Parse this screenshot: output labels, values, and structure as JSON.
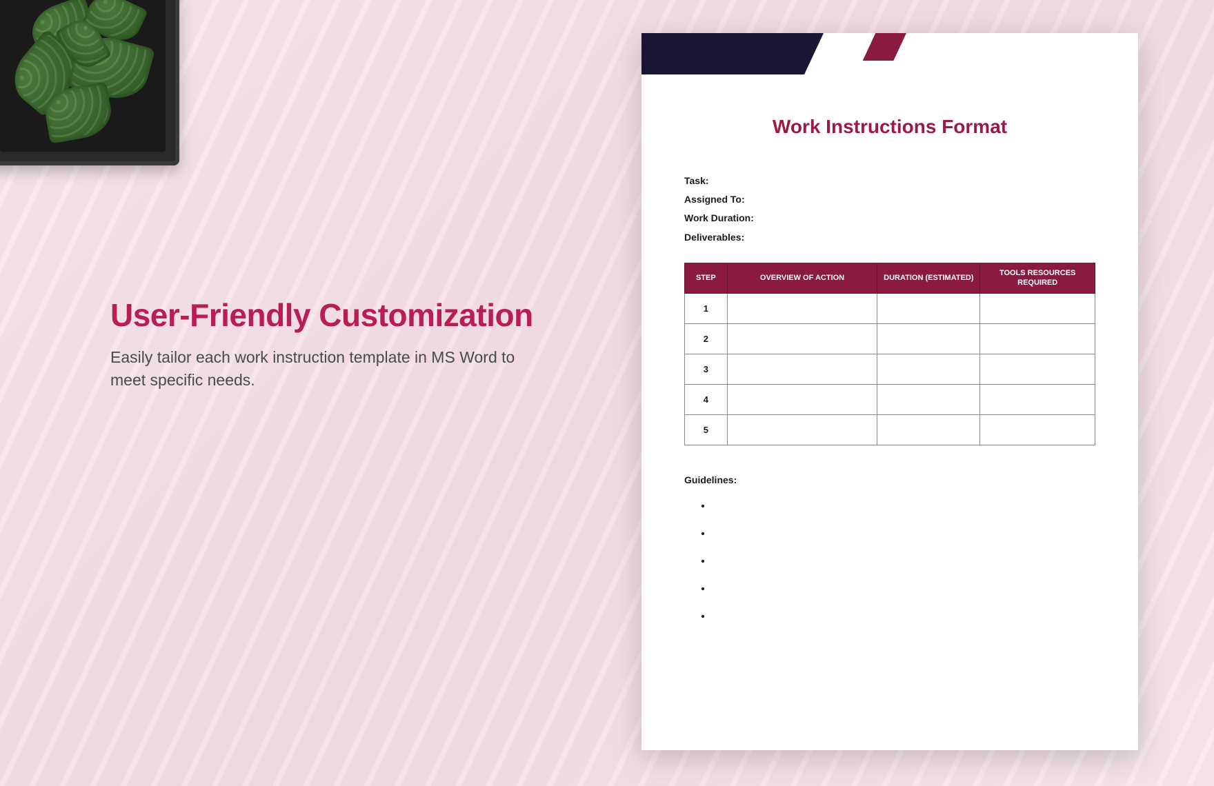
{
  "marketing": {
    "headline": "User-Friendly Customization",
    "subhead": "Easily tailor each work instruction template  in MS Word to meet specific needs."
  },
  "document": {
    "title": "Work Instructions Format",
    "fields": {
      "task_label": "Task:",
      "assigned_label": "Assigned To:",
      "duration_label": "Work Duration:",
      "deliverables_label": "Deliverables:"
    },
    "table": {
      "headers": {
        "step": "STEP",
        "action": "OVERVIEW OF ACTION",
        "duration": "DURATION (ESTIMATED)",
        "tools": "TOOLS RESOURCES REQUIRED"
      },
      "rows": [
        {
          "step": "1",
          "action": "",
          "duration": "",
          "tools": ""
        },
        {
          "step": "2",
          "action": "",
          "duration": "",
          "tools": ""
        },
        {
          "step": "3",
          "action": "",
          "duration": "",
          "tools": ""
        },
        {
          "step": "4",
          "action": "",
          "duration": "",
          "tools": ""
        },
        {
          "step": "5",
          "action": "",
          "duration": "",
          "tools": ""
        }
      ]
    },
    "guidelines_label": "Guidelines:",
    "guidelines": [
      "",
      "",
      "",
      "",
      ""
    ]
  },
  "colors": {
    "accent": "#b81d56",
    "table_header": "#8a1a3f",
    "doc_band_dark": "#1a1533",
    "doc_band_pink": "#d63068"
  }
}
